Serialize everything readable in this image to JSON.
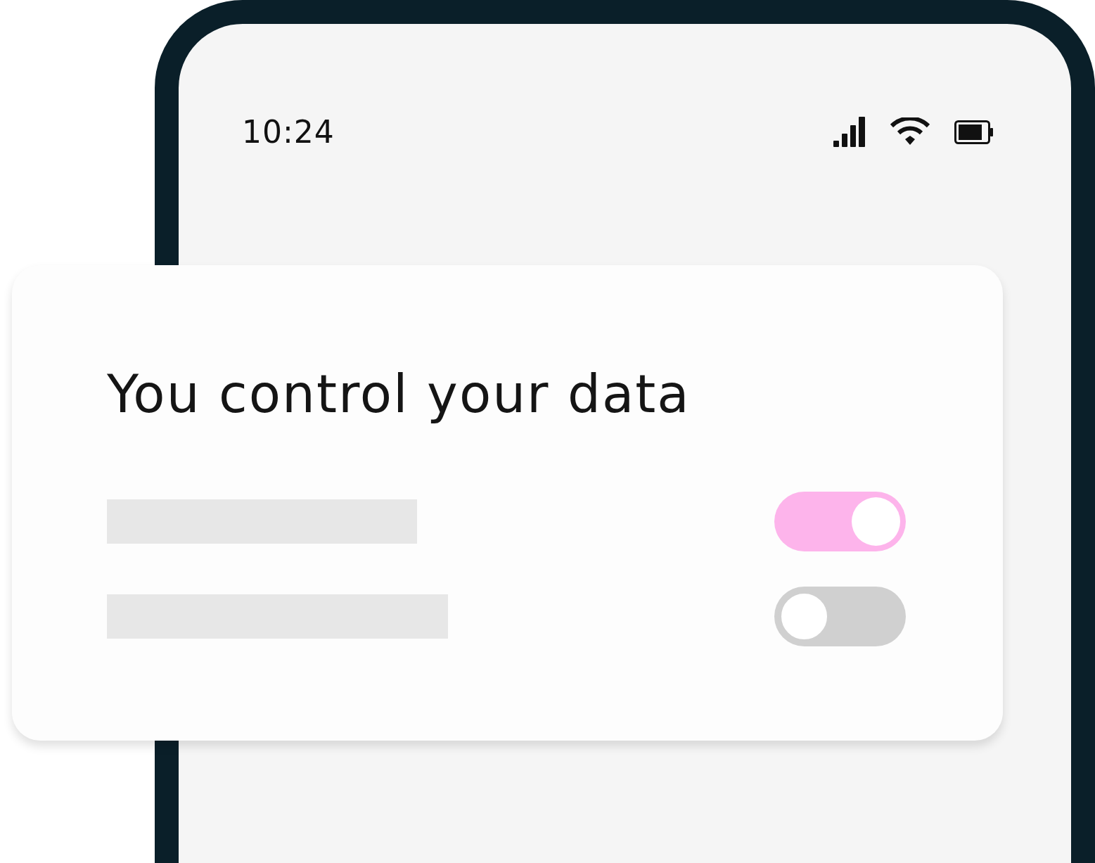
{
  "status_bar": {
    "time": "10:24"
  },
  "card": {
    "title": "You control your data",
    "rows": [
      {
        "on": true
      },
      {
        "on": false
      }
    ]
  }
}
